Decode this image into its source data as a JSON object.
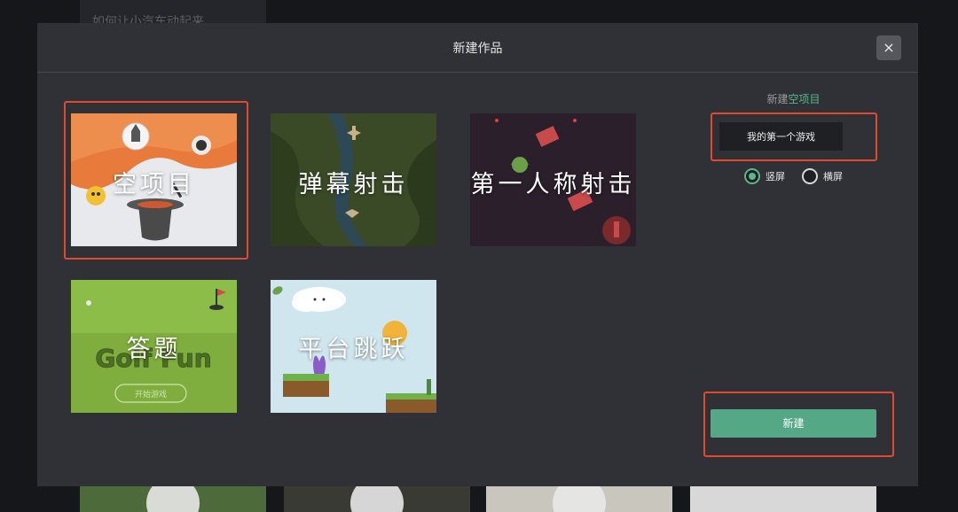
{
  "background": {
    "top_card_text": "如何让小汽车动起来"
  },
  "modal": {
    "title": "新建作品",
    "close_label": "×"
  },
  "templates": [
    {
      "label": "空项目"
    },
    {
      "label": "弹幕射击"
    },
    {
      "label": "第一人称射击"
    },
    {
      "label": "答题",
      "art_text": "Golf Fun",
      "art_button": "开始游戏"
    },
    {
      "label": "平台跳跃"
    }
  ],
  "panel": {
    "title_prefix": "新建",
    "title_selected": "空项目",
    "project_name": "我的第一个游戏",
    "orientation": {
      "portrait": "竖屏",
      "landscape": "横屏",
      "selected": "portrait"
    },
    "create_label": "新建"
  },
  "colors": {
    "accent": "#5bb58d",
    "button": "#55a886",
    "highlight": "#e04a2f",
    "modal_bg": "#2f3136"
  }
}
